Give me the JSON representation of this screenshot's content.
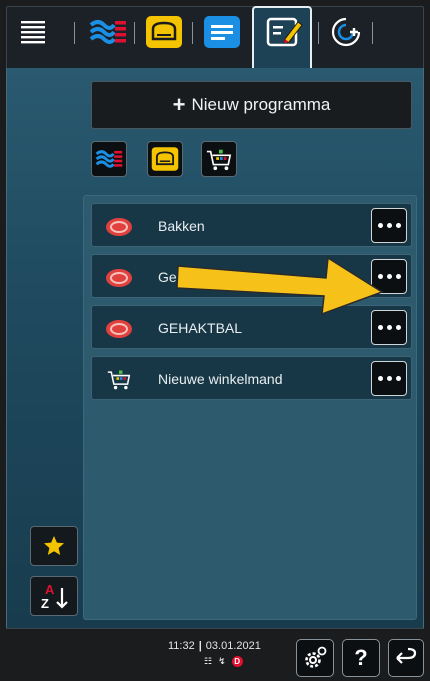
{
  "new_program_label": "Nieuw programma",
  "new_program_plus": "+",
  "programs": [
    {
      "label": "Bakken",
      "icon": "meat-icon"
    },
    {
      "label": "Ge",
      "icon": "meat-icon"
    },
    {
      "label": "GEHAKTBAL",
      "icon": "meat-icon"
    },
    {
      "label": "Nieuwe winkelmand",
      "icon": "shopping-basket-icon"
    }
  ],
  "status": {
    "time": "11:32",
    "separator": "|",
    "date": "03.01.2021",
    "badge": "D"
  },
  "bottom_buttons": {
    "help": "?"
  },
  "sort_label_a": "A",
  "sort_label_z": "Z",
  "colors": {
    "accent_yellow": "#f5c400",
    "accent_blue": "#1a8fe3",
    "red": "#e01030",
    "arrow": "#f6c21a"
  }
}
